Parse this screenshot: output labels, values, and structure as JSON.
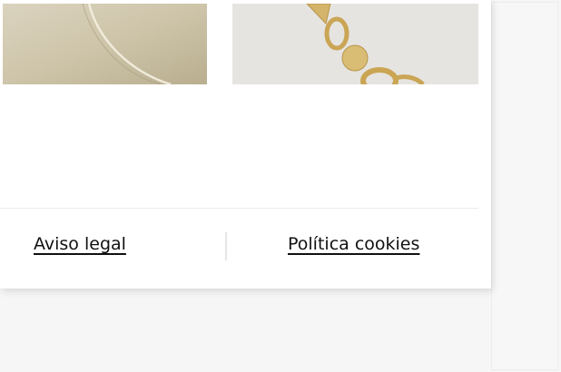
{
  "footer": {
    "legal_label": "Aviso legal",
    "cookies_label": "Política cookies"
  },
  "products": [
    {
      "image": "gold-leather-texture"
    },
    {
      "image": "gold-chain-necklace"
    }
  ],
  "colors": {
    "page_bg": "#f6f6f6",
    "card_bg": "#ffffff",
    "link_text": "#111111",
    "gold": "#c9a85a"
  }
}
